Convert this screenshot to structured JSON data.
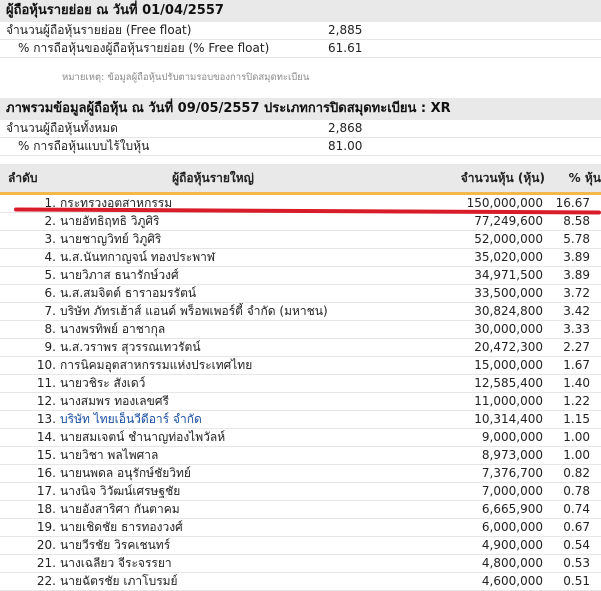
{
  "retail": {
    "title": "ผู้ถือหุ้นรายย่อย ณ วันที่ 01/04/2557",
    "rows": [
      {
        "label": "จำนวนผู้ถือหุ้นรายย่อย (Free float)",
        "value": "2,885"
      },
      {
        "label": "% การถือหุ้นของผู้ถือหุ้นรายย่อย (% Free float)",
        "value": "61.61"
      }
    ],
    "note": "หมายเหตุ: ข้อมูลผู้ถือหุ้นปรับตามรอบของการปิดสมุดทะเบียน"
  },
  "overview": {
    "title": "ภาพรวมข้อมูลผู้ถือหุ้น ณ วันที่ 09/05/2557 ประเภทการปิดสมุดทะเบียน : XR",
    "rows": [
      {
        "label": "จำนวนผู้ถือหุ้นทั้งหมด",
        "value": "2,868"
      },
      {
        "label": "% การถือหุ้นแบบไร้ใบหุ้น",
        "value": "81.00"
      }
    ]
  },
  "major": {
    "headers": {
      "rank": "ลำดับ",
      "name": "ผู้ถือหุ้นรายใหญ่",
      "shares": "จำนวนหุ้น (หุ้น)",
      "pct": "% หุ้น"
    },
    "rows": [
      {
        "rank": "1.",
        "name": "กระทรวงอุตสาหกรรม",
        "shares": "150,000,000",
        "pct": "16.67"
      },
      {
        "rank": "2.",
        "name": "นายอัทธิฤทธิ วิภูศิริ",
        "shares": "77,249,600",
        "pct": "8.58"
      },
      {
        "rank": "3.",
        "name": "นายชาญวิทย์ วิภูศิริ",
        "shares": "52,000,000",
        "pct": "5.78"
      },
      {
        "rank": "4.",
        "name": "น.ส.นันทกาญจน์ ทองประพาฬ",
        "shares": "35,020,000",
        "pct": "3.89"
      },
      {
        "rank": "5.",
        "name": "นายวิภาส ธนารักษ์วงศ์",
        "shares": "34,971,500",
        "pct": "3.89"
      },
      {
        "rank": "6.",
        "name": "น.ส.สมจิตต์ ธาราอมรรัตน์",
        "shares": "33,500,000",
        "pct": "3.72"
      },
      {
        "rank": "7.",
        "name": "บริษัท ภัทรเฮ้าส์ แอนด์ พร็อพเพอร์ตี้ จำกัด (มหาชน)",
        "shares": "30,824,800",
        "pct": "3.42"
      },
      {
        "rank": "8.",
        "name": "นางพรทิพย์ อาชากุล",
        "shares": "30,000,000",
        "pct": "3.33"
      },
      {
        "rank": "9.",
        "name": "น.ส.วราพร สุวรรณเทวรัตน์",
        "shares": "20,472,300",
        "pct": "2.27"
      },
      {
        "rank": "10.",
        "name": "การนิคมอุตสาหกรรมแห่งประเทศไทย",
        "shares": "15,000,000",
        "pct": "1.67"
      },
      {
        "rank": "11.",
        "name": "นายวชิระ สังเดว์",
        "shares": "12,585,400",
        "pct": "1.40"
      },
      {
        "rank": "12.",
        "name": "นางสมพร ทองเลขศรี",
        "shares": "11,000,000",
        "pct": "1.22"
      },
      {
        "rank": "13.",
        "name": "บริษัท ไทยเอ็นวีดีอาร์ จำกัด",
        "shares": "10,314,400",
        "pct": "1.15"
      },
      {
        "rank": "14.",
        "name": "นายสมเจตน์ ชำนาญท่องไพวัลห์",
        "shares": "9,000,000",
        "pct": "1.00"
      },
      {
        "rank": "15.",
        "name": "นายวิชา พลไพศาล",
        "shares": "8,973,000",
        "pct": "1.00"
      },
      {
        "rank": "16.",
        "name": "นายนพดล อนุรักษ์ชัยวิทย์",
        "shares": "7,376,700",
        "pct": "0.82"
      },
      {
        "rank": "17.",
        "name": "นางนิจ วิวัฒน์เศรษฐชัย",
        "shares": "7,000,000",
        "pct": "0.78"
      },
      {
        "rank": "18.",
        "name": "นายอังสาริศา กันตาคม",
        "shares": "6,665,900",
        "pct": "0.74"
      },
      {
        "rank": "19.",
        "name": "นายเชิดชัย ธารทองวงศ์",
        "shares": "6,000,000",
        "pct": "0.67"
      },
      {
        "rank": "20.",
        "name": "นายวีรชัย วิรคเชนทร์",
        "shares": "4,900,000",
        "pct": "0.54"
      },
      {
        "rank": "21.",
        "name": "นางเฉลียว จีระจรรยา",
        "shares": "4,800,000",
        "pct": "0.53"
      },
      {
        "rank": "22.",
        "name": "นายฉัตรชัย เภาโบรมย์",
        "shares": "4,600,000",
        "pct": "0.51"
      }
    ]
  },
  "colors": {
    "header_bg": "#e9e9e9",
    "header_underline": "#f5b64a",
    "highlight": "#d81c2a",
    "link": "#1a4fa0"
  }
}
